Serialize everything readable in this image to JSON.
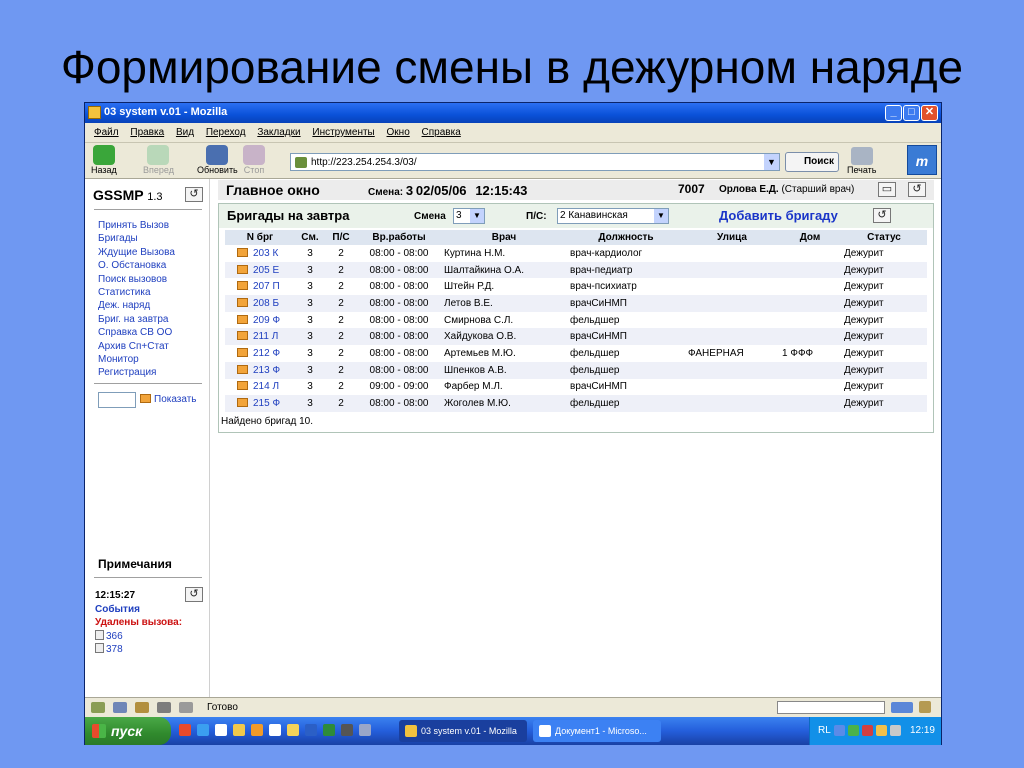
{
  "slide": {
    "title": "Формирование смены в дежурном наряде"
  },
  "window": {
    "title": "03 system v.01 - Mozilla",
    "controls": {
      "minimize": "_",
      "maximize": "□",
      "close": "✕"
    }
  },
  "menu": [
    "Файл",
    "Правка",
    "Вид",
    "Переход",
    "Закладки",
    "Инструменты",
    "Окно",
    "Справка"
  ],
  "toolbar": {
    "back": "Назад",
    "forward": "Вперед",
    "reload": "Обновить",
    "stop": "Стоп",
    "url": "http://223.254.254.3/03/",
    "search": "Поиск",
    "print": "Печать"
  },
  "sidebar": {
    "brand": "GSSMP",
    "version": "1.3",
    "items": [
      "Принять Вызов",
      "Бригады",
      "Ждущие Вызова",
      "О. Обстановка",
      "Поиск вызовов",
      "Статистика",
      "Деж. наряд",
      "Бриг. на завтра",
      "Справка СВ ОО",
      "Архив Сп+Стат",
      "Монитор",
      "Регистрация"
    ],
    "show_button": "Показать",
    "notes": {
      "title": "Примечания",
      "time": "12:15:27",
      "events": "События",
      "deleted": "Удалены вызова:",
      "calls": [
        "366",
        "378"
      ]
    }
  },
  "header": {
    "main": "Главное окно",
    "shift_label": "Смена:",
    "shift_value": "3",
    "date": "02/05/06",
    "time": "12:15:43",
    "number": "7007",
    "doctor": "Орлова Е.Д.",
    "role": "(Старший врач)"
  },
  "panel": {
    "title": "Бригады на завтра",
    "shift_label": "Смена",
    "shift_value": "3",
    "ps_label": "П/С:",
    "ps_value": "2 Канавинская",
    "add_button": "Добавить бригаду",
    "columns": [
      "N брг",
      "См.",
      "П/С",
      "Вр.работы",
      "Врач",
      "Должность",
      "Улица",
      "Дом",
      "Статус"
    ],
    "rows": [
      [
        "203 К",
        "3",
        "2",
        "08:00 - 08:00",
        "Куртина Н.М.",
        "врач-кардиолог",
        "",
        "",
        "Дежурит"
      ],
      [
        "205 Е",
        "3",
        "2",
        "08:00 - 08:00",
        "Шалтайкина О.А.",
        "врач-педиатр",
        "",
        "",
        "Дежурит"
      ],
      [
        "207 П",
        "3",
        "2",
        "08:00 - 08:00",
        "Штейн Р.Д.",
        "врач-психиатр",
        "",
        "",
        "Дежурит"
      ],
      [
        "208 Б",
        "3",
        "2",
        "08:00 - 08:00",
        "Летов В.Е.",
        "врачСиНМП",
        "",
        "",
        "Дежурит"
      ],
      [
        "209 Ф",
        "3",
        "2",
        "08:00 - 08:00",
        "Смирнова С.Л.",
        "фельдшер",
        "",
        "",
        "Дежурит"
      ],
      [
        "211 Л",
        "3",
        "2",
        "08:00 - 08:00",
        "Хайдукова О.В.",
        "врачСиНМП",
        "",
        "",
        "Дежурит"
      ],
      [
        "212 Ф",
        "3",
        "2",
        "08:00 - 08:00",
        "Артемьев М.Ю.",
        "фельдшер",
        "ФАНЕРНАЯ",
        "1 ФФФ",
        "Дежурит"
      ],
      [
        "213 Ф",
        "3",
        "2",
        "08:00 - 08:00",
        "Шпенков А.В.",
        "фельдшер",
        "",
        "",
        "Дежурит"
      ],
      [
        "214 Л",
        "3",
        "2",
        "09:00 - 09:00",
        "Фарбер М.Л.",
        "врачСиНМП",
        "",
        "",
        "Дежурит"
      ],
      [
        "215 Ф",
        "3",
        "2",
        "08:00 - 08:00",
        "Жоголев М.Ю.",
        "фельдшер",
        "",
        "",
        "Дежурит"
      ]
    ],
    "found": "Найдено бригад 10."
  },
  "status": {
    "text": "Готово"
  },
  "taskbar": {
    "start": "пуск",
    "tasks": [
      "03 system v.01 - Mozilla",
      "Документ1 - Microso..."
    ],
    "lang": "RL",
    "clock": "12:19"
  }
}
